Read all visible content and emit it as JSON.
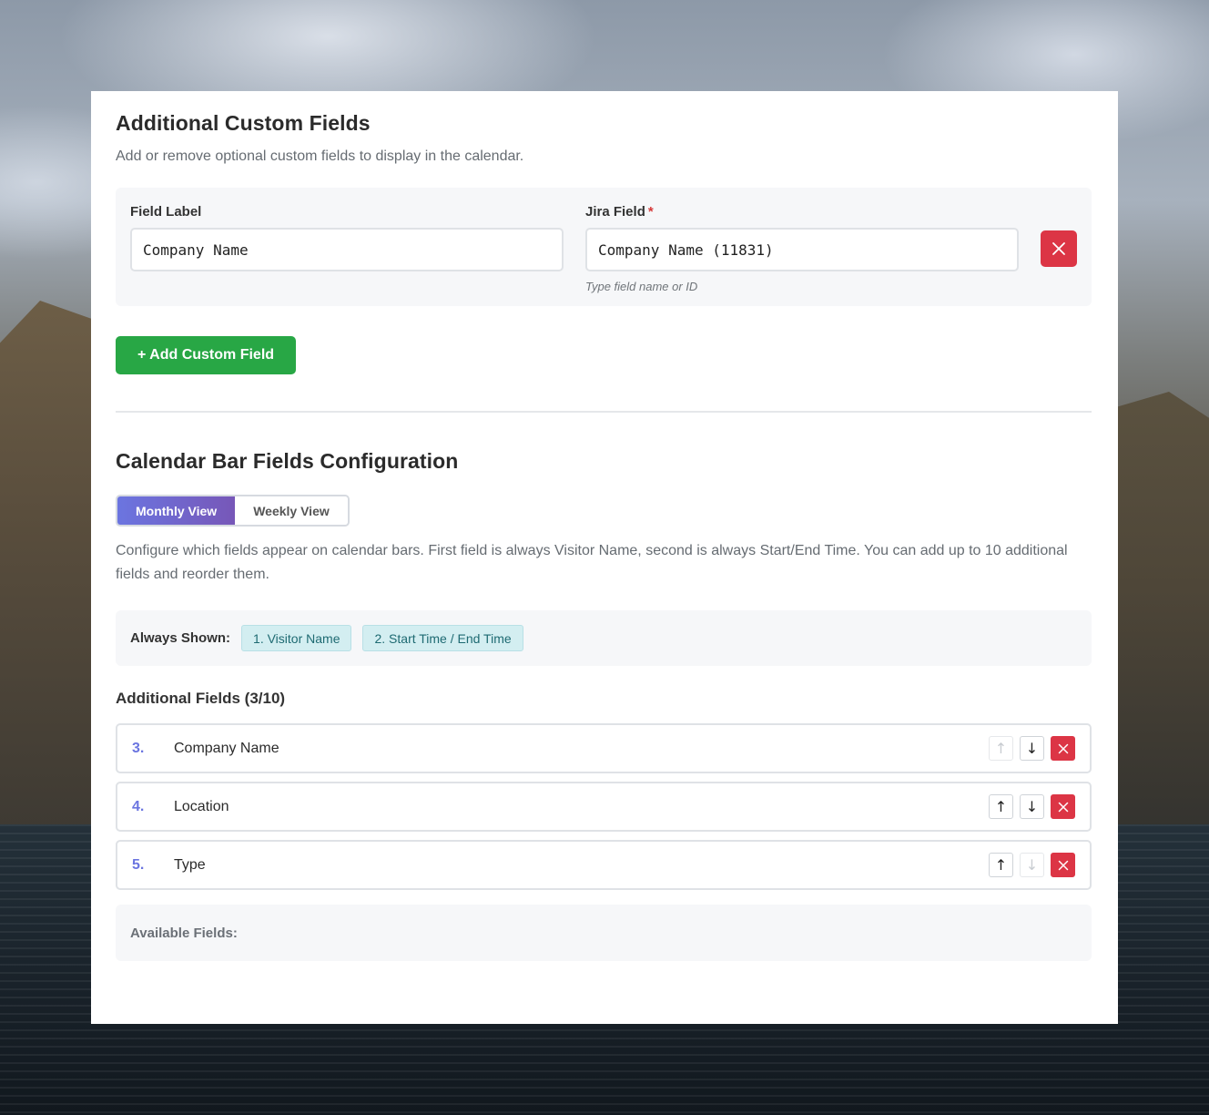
{
  "custom_fields": {
    "title": "Additional Custom Fields",
    "subtitle": "Add or remove optional custom fields to display in the calendar.",
    "field_label_title": "Field Label",
    "field_label_value": "Company Name",
    "jira_field_title": "Jira Field",
    "jira_field_required_mark": "*",
    "jira_field_value": "Company Name (11831)",
    "jira_field_hint": "Type field name or ID",
    "delete_icon": "close-icon",
    "add_button_label": "+ Add Custom Field"
  },
  "calendar_bar": {
    "title": "Calendar Bar Fields Configuration",
    "tabs": [
      {
        "label": "Monthly View",
        "active": true
      },
      {
        "label": "Weekly View",
        "active": false
      }
    ],
    "description": "Configure which fields appear on calendar bars. First field is always Visitor Name, second is always Start/End Time. You can add up to 10 additional fields and reorder them.",
    "always_shown_label": "Always Shown:",
    "always_shown_chips": [
      "1. Visitor Name",
      "2. Start Time / End Time"
    ],
    "additional_title": "Additional Fields (3/10)",
    "additional_fields": [
      {
        "num": "3.",
        "name": "Company Name",
        "up_disabled": true,
        "down_disabled": false
      },
      {
        "num": "4.",
        "name": "Location",
        "up_disabled": false,
        "down_disabled": false
      },
      {
        "num": "5.",
        "name": "Type",
        "up_disabled": false,
        "down_disabled": true
      }
    ],
    "available_label": "Available Fields:"
  },
  "icons": {
    "up": "arrow-up-icon",
    "down": "arrow-down-icon",
    "remove": "close-icon"
  },
  "colors": {
    "primary_gradient_start": "#6b75e0",
    "primary_gradient_end": "#7757b8",
    "danger": "#dc3545",
    "success": "#28a745",
    "chip_bg": "#d3eef1",
    "chip_text": "#1e6a72"
  }
}
